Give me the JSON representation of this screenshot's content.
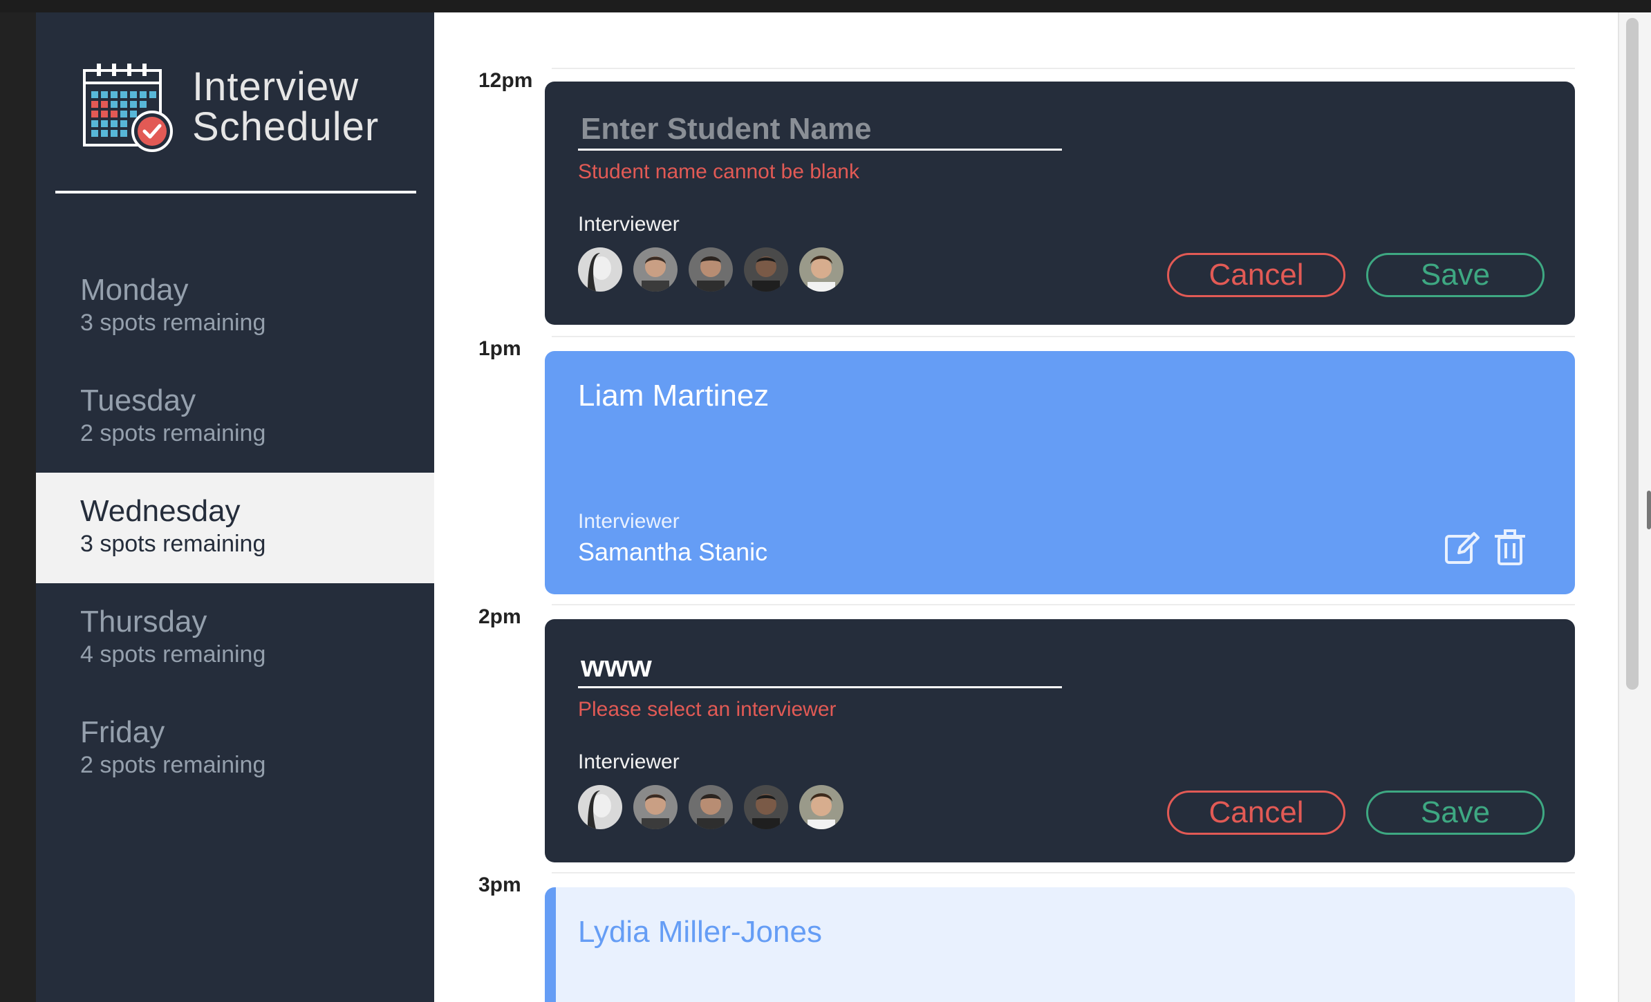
{
  "app": {
    "brand_line1": "Interview",
    "brand_line2": "Scheduler"
  },
  "sidebar": {
    "days": [
      {
        "name": "Monday",
        "spots": "3 spots remaining",
        "selected": false
      },
      {
        "name": "Tuesday",
        "spots": "2 spots remaining",
        "selected": false
      },
      {
        "name": "Wednesday",
        "spots": "3 spots remaining",
        "selected": true
      },
      {
        "name": "Thursday",
        "spots": "4 spots remaining",
        "selected": false
      },
      {
        "name": "Friday",
        "spots": "2 spots remaining",
        "selected": false
      }
    ]
  },
  "schedule": {
    "times": [
      "12pm",
      "1pm",
      "2pm",
      "3pm"
    ],
    "appt1": {
      "placeholder": "Enter Student Name",
      "value": "",
      "error": "Student name cannot be blank",
      "interviewer_label": "Interviewer",
      "cancel": "Cancel",
      "save": "Save"
    },
    "appt2": {
      "student": "Liam Martinez",
      "interviewer_label": "Interviewer",
      "interviewer": "Samantha Stanic"
    },
    "appt3": {
      "placeholder": "Enter Student Name",
      "value": "www",
      "error": "Please select an interviewer",
      "interviewer_label": "Interviewer",
      "cancel": "Cancel",
      "save": "Save"
    },
    "appt4": {
      "student": "Lydia Miller-Jones"
    }
  },
  "colors": {
    "sidebar_bg": "#252d3b",
    "show_card": "#659df5",
    "danger": "#e25a55",
    "success": "#3ea882"
  },
  "icons": [
    "calendar-logo-icon",
    "edit-icon",
    "trash-icon"
  ]
}
